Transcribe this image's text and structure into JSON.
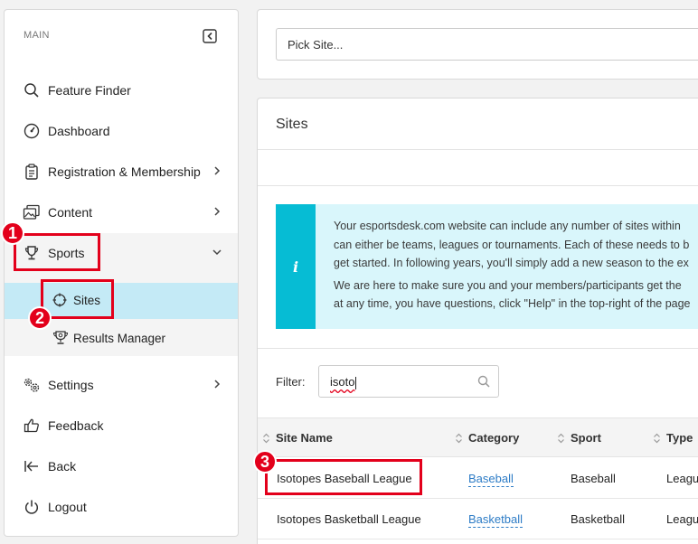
{
  "sidebar": {
    "section_label": "MAIN",
    "items": [
      {
        "label": "Feature Finder"
      },
      {
        "label": "Dashboard"
      },
      {
        "label": "Registration & Membership"
      },
      {
        "label": "Content"
      },
      {
        "label": "Sports"
      },
      {
        "label": "Settings"
      },
      {
        "label": "Feedback"
      },
      {
        "label": "Back"
      },
      {
        "label": "Logout"
      }
    ],
    "sub_items": [
      {
        "label": "Sites"
      },
      {
        "label": "Results Manager"
      }
    ]
  },
  "site_picker": {
    "placeholder": "Pick Site..."
  },
  "sites_panel": {
    "title": "Sites",
    "info": {
      "line1": "Your esportsdesk.com website can include any number of sites within",
      "line2": "can either be teams, leagues or tournaments. Each of these needs to b",
      "line3": "get started. In following years, you'll simply add a new season to the ex",
      "line4": "We are here to make sure you and your members/participants get the",
      "line5": "at any time, you have questions, click \"Help\" in the top-right of the page"
    },
    "filter": {
      "label": "Filter:",
      "value": "isoto"
    },
    "table": {
      "headers": [
        "Site Name",
        "Category",
        "Sport",
        "Type"
      ],
      "rows": [
        {
          "site_name": "Isotopes Baseball League",
          "category": "Baseball",
          "sport": "Baseball",
          "type": "Leagu"
        },
        {
          "site_name": "Isotopes Basketball League",
          "category": "Basketball",
          "sport": "Basketball",
          "type": "Leagu"
        }
      ]
    }
  },
  "annotations": {
    "badge1": "1",
    "badge2": "2",
    "badge3": "3"
  },
  "colors": {
    "accent": "#06bcd4",
    "highlight": "#c4eaf6",
    "annotation": "#e3001b",
    "link": "#2d7cc6"
  }
}
